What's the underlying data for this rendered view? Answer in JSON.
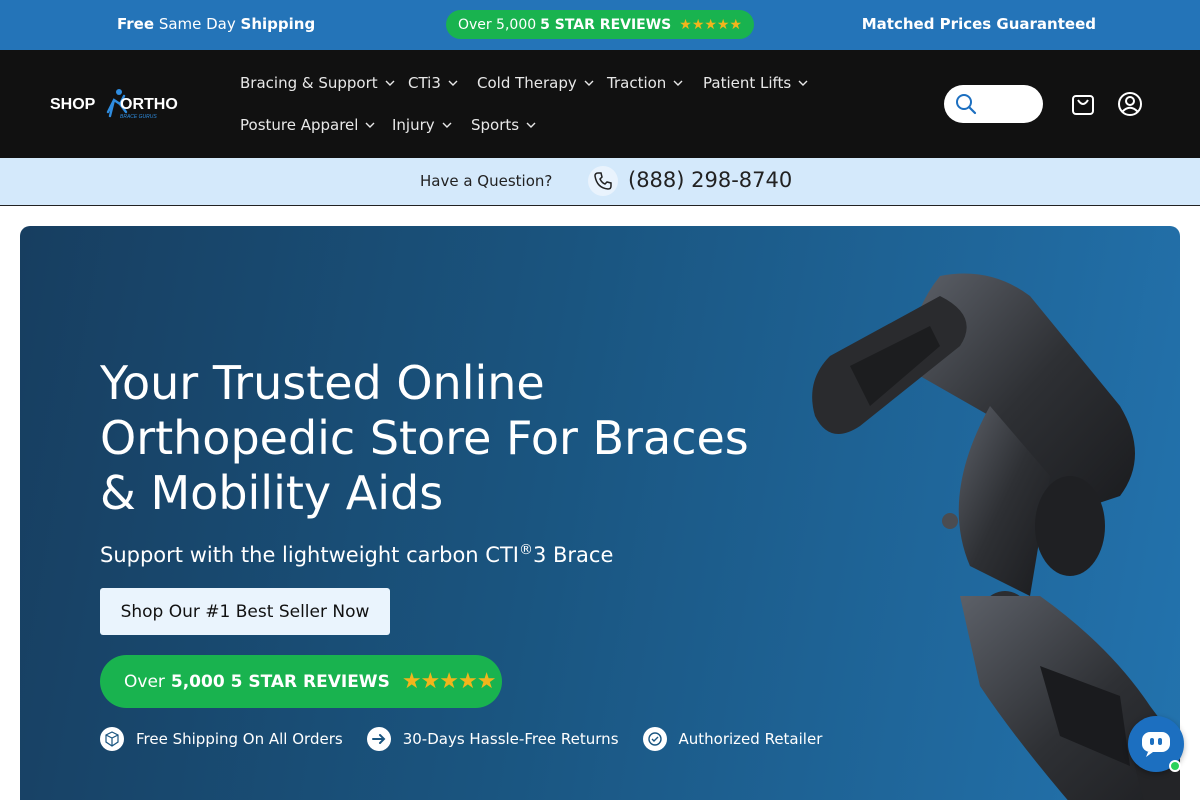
{
  "promo": {
    "left_bold1": "Free",
    "left_mid": "Same Day",
    "left_bold2": "Shipping",
    "center_prefix": "Over 5,000",
    "center_bold": "5 STAR REVIEWS",
    "center_stars": "★★★★★",
    "right": "Matched Prices Guaranteed"
  },
  "header": {
    "logo_text": "SHOP ORTHO",
    "logo_tagline": "BRACE GURUS",
    "nav": [
      {
        "label": "Bracing & Support"
      },
      {
        "label": "CTi3"
      },
      {
        "label": "Cold Therapy"
      },
      {
        "label": "Traction"
      },
      {
        "label": "Patient Lifts"
      },
      {
        "label": "Posture Apparel"
      },
      {
        "label": "Injury"
      },
      {
        "label": "Sports"
      }
    ],
    "search_placeholder": ""
  },
  "question_bar": {
    "text": "Have a Question?",
    "phone": "(888) 298-8740"
  },
  "hero": {
    "title": "Your Trusted Online Orthopedic Store For Braces & Mobility Aids",
    "subtitle_pre": "Support with the lightweight carbon CTI",
    "subtitle_sup": "®",
    "subtitle_post": "3 Brace",
    "cta_label": "Shop Our #1 Best Seller Now",
    "reviews_prefix": "Over",
    "reviews_bold": "5,000 5 STAR REVIEWS",
    "reviews_stars": "★★★★★",
    "features": [
      {
        "label": "Free Shipping On All Orders",
        "icon": "box-icon"
      },
      {
        "label": "30-Days Hassle-Free Returns",
        "icon": "arrow-right-icon"
      },
      {
        "label": "Authorized Retailer",
        "icon": "check-badge-icon"
      }
    ]
  },
  "colors": {
    "promo_bg": "#2474b8",
    "header_bg": "#111111",
    "question_bg": "#d4e9fb",
    "hero_bg": "#1a5580",
    "green": "#19b34f",
    "star": "#f2b51c",
    "chat": "#1c6fc0"
  }
}
